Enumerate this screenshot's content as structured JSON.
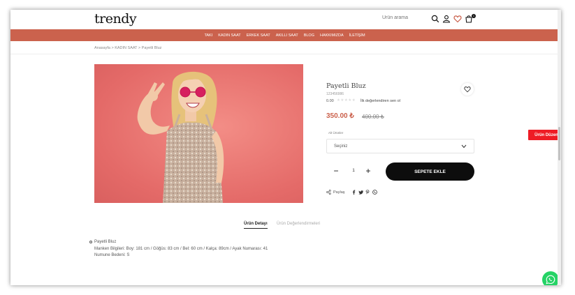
{
  "header": {
    "logo": "trendy",
    "search_placeholder": "Ürün arama",
    "cart_count": "1"
  },
  "nav": {
    "items": [
      {
        "label": "TAKI"
      },
      {
        "label": "KADIN SAAT"
      },
      {
        "label": "ERKEK SAAT"
      },
      {
        "label": "AKILLI SAAT"
      },
      {
        "label": "BLOG"
      },
      {
        "label": "HAKKIMIZDA"
      },
      {
        "label": "İLETİŞİM"
      }
    ]
  },
  "breadcrumb": "Anasayfa > KADIN SAAT > Payetli Bluz",
  "product": {
    "title": "Payetli Bluz",
    "sku": "123456986",
    "rating_score": "0.00",
    "stars": "★★★★★",
    "review_link": "İlk değerlendiren sen ol",
    "price": "350.00 ₺",
    "old_price": "400.00 ₺",
    "variant_label": "Alt Ürünler",
    "variant_selected": "Seçiniz",
    "qty_minus": "−",
    "qty_plus": "+",
    "quantity": "1",
    "add_to_cart": "SEPETE EKLE",
    "share_label": "Paylaş"
  },
  "tabs": {
    "detail": "Ürün Detayı",
    "reviews": "Ürün Değerlendirmeleri"
  },
  "description": {
    "line1": "Payetli Bluz",
    "line2": "Manken Bilgileri: Boy: 181 cm / Göğüs: 83 cm / Bel: 60 cm / Kalça: 89cm / Ayak Numarası: 41",
    "line3": "Numune Bedeni: S"
  },
  "floating": {
    "edit_button": "Ürün Düzenle"
  },
  "colors": {
    "accent": "#cb624d",
    "nav_bg": "#cb624d",
    "edit_red": "#ee1c25",
    "whatsapp": "#25d366"
  }
}
